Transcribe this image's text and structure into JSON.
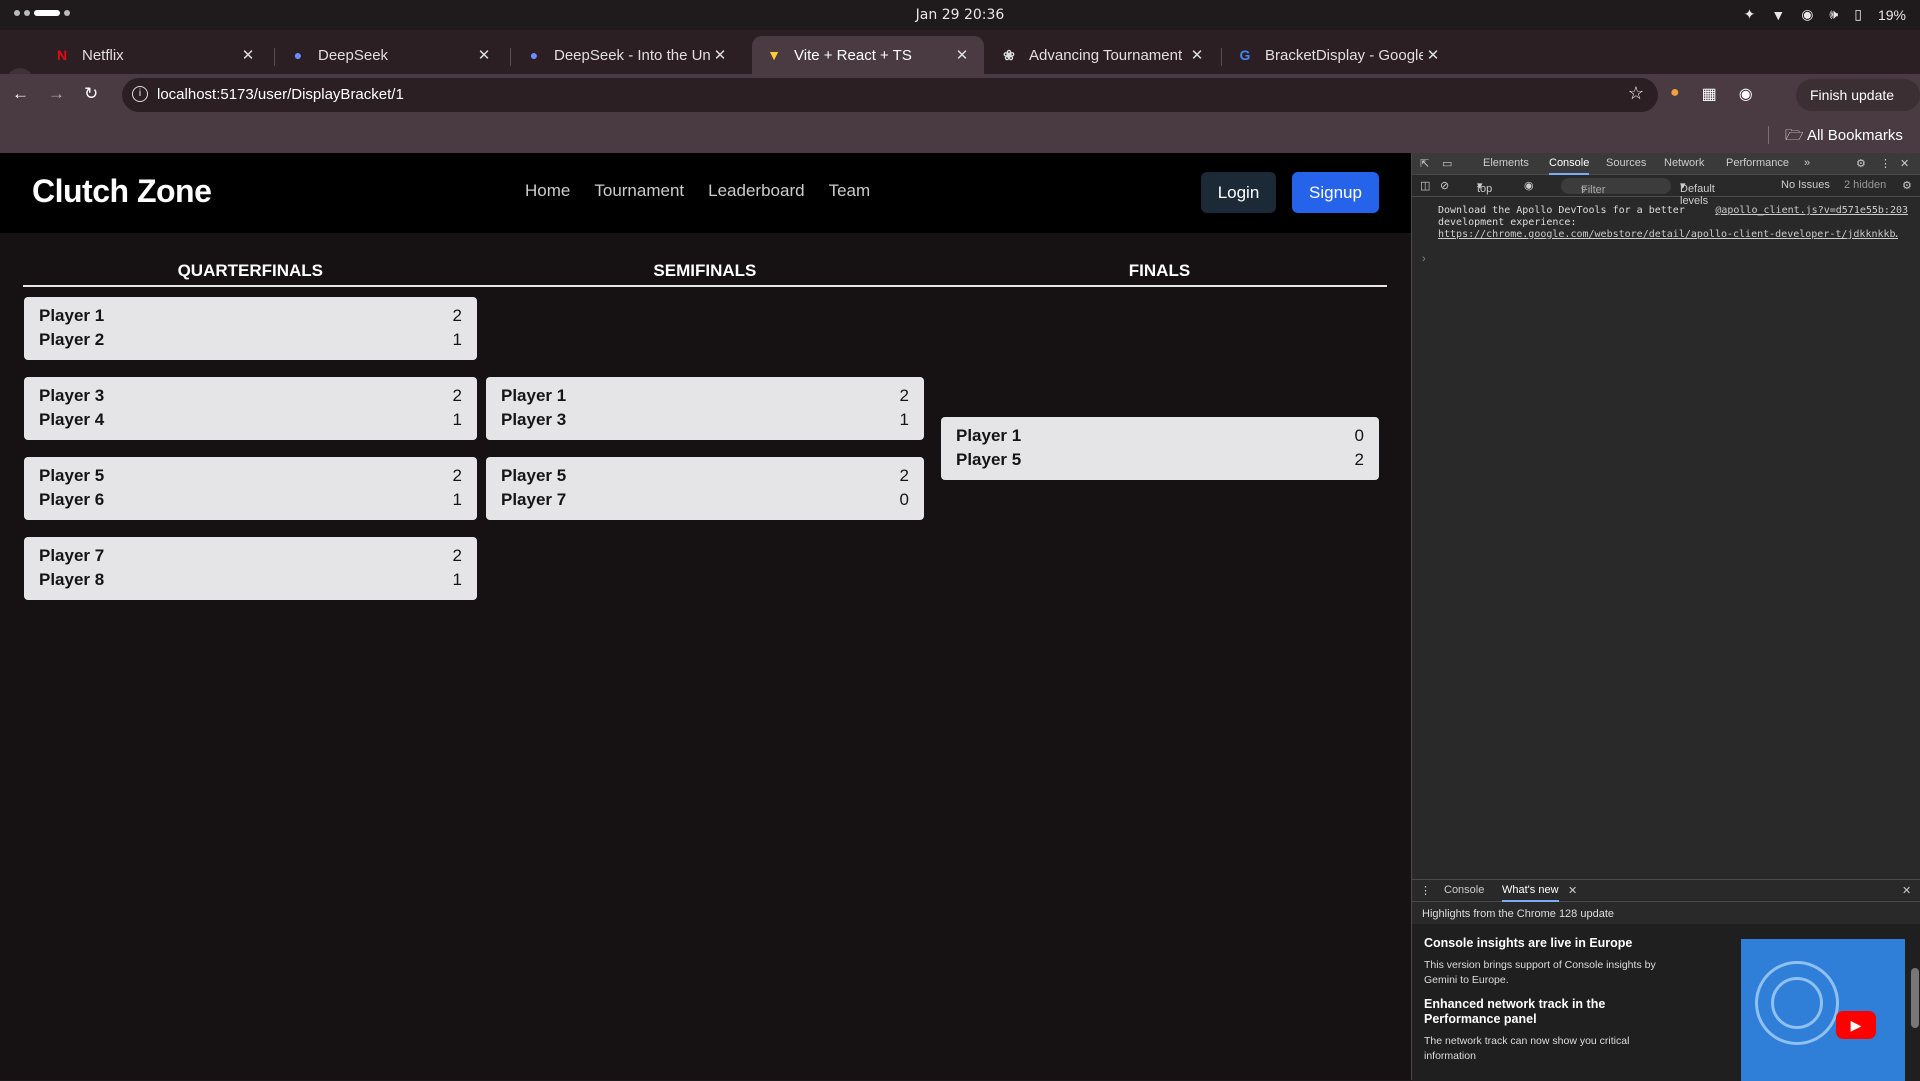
{
  "system": {
    "clock": "Jan 29  20:36",
    "battery": "19%"
  },
  "browser": {
    "tabs": [
      {
        "title": "Netflix",
        "icon": "N"
      },
      {
        "title": "DeepSeek",
        "icon": "deepseek-icon"
      },
      {
        "title": "DeepSeek - Into the Unkn",
        "icon": "deepseek-icon"
      },
      {
        "title": "Vite + React + TS",
        "icon": "vite-icon"
      },
      {
        "title": "Advancing Tournament F",
        "icon": "openai-icon"
      },
      {
        "title": "BracketDisplay - Google S",
        "icon": "G"
      }
    ],
    "url": "localhost:5173/user/DisplayBracket/1",
    "finish_update": "Finish update",
    "bookmarks": "All Bookmarks"
  },
  "app": {
    "logo": "Clutch Zone",
    "nav": [
      "Home",
      "Tournament",
      "Leaderboard",
      "Team"
    ],
    "login": "Login",
    "signup": "Signup",
    "colors": {
      "signup": "#2563eb",
      "login": "#1c2937",
      "card": "#e5e5e7"
    }
  },
  "bracket": {
    "rounds": [
      "QUARTERFINALS",
      "SEMIFINALS",
      "FINALS"
    ],
    "quarterfinals": [
      {
        "p1": "Player 1",
        "s1": "2",
        "p2": "Player 2",
        "s2": "1"
      },
      {
        "p1": "Player 3",
        "s1": "2",
        "p2": "Player 4",
        "s2": "1"
      },
      {
        "p1": "Player 5",
        "s1": "2",
        "p2": "Player 6",
        "s2": "1"
      },
      {
        "p1": "Player 7",
        "s1": "2",
        "p2": "Player 8",
        "s2": "1"
      }
    ],
    "semifinals": [
      {
        "p1": "Player 1",
        "s1": "2",
        "p2": "Player 3",
        "s2": "1"
      },
      {
        "p1": "Player 5",
        "s1": "2",
        "p2": "Player 7",
        "s2": "0"
      }
    ],
    "finals": [
      {
        "p1": "Player 1",
        "s1": "0",
        "p2": "Player 5",
        "s2": "2"
      }
    ]
  },
  "devtools": {
    "tabs": [
      "Elements",
      "Console",
      "Sources",
      "Network",
      "Performance"
    ],
    "context": "top",
    "filter": "Filter",
    "levels": "Default levels",
    "issues": "No Issues",
    "hidden": "2 hidden",
    "message_line1": "Download the Apollo DevTools for a better",
    "message_line2": "development experience:",
    "message_link": "https://chrome.google.com/webstore/detail/apollo-client-developer-t/jdkknkkb…",
    "message_source": "@apollo_client.js?v=d571e55b:203",
    "drawer_tabs": [
      "Console",
      "What's new"
    ],
    "highlights": "Highlights from the Chrome 128 update",
    "news": [
      {
        "title": "Console insights are live in Europe",
        "desc": "This version brings support of Console insights by Gemini to Europe."
      },
      {
        "title": "Enhanced network track in the Performance panel",
        "desc": "The network track can now show you critical information"
      }
    ]
  }
}
